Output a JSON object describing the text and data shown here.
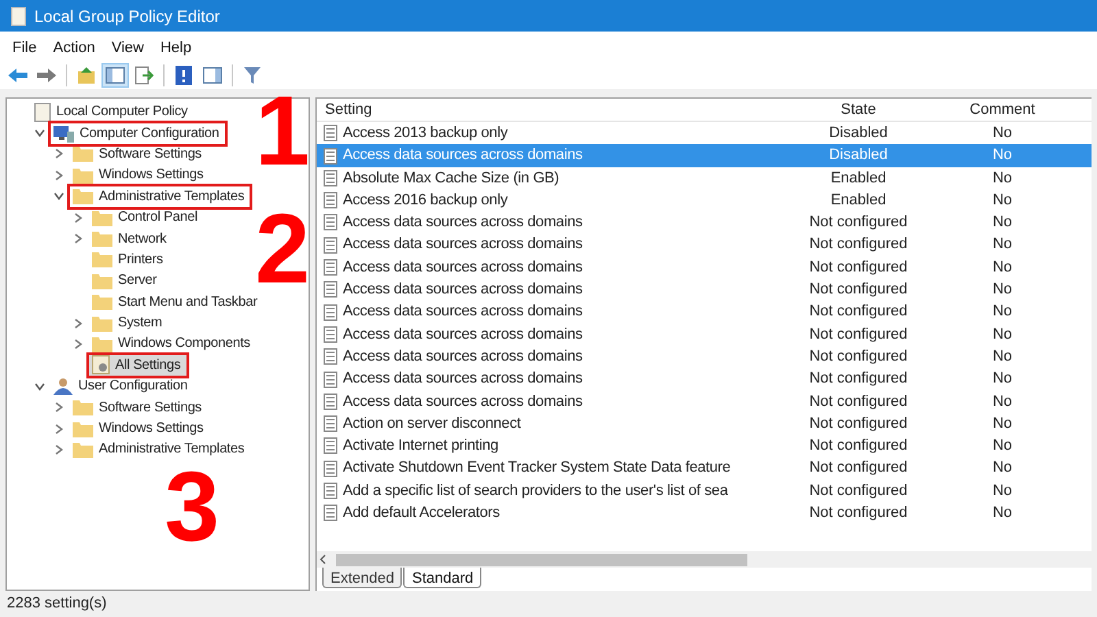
{
  "window": {
    "title": "Local Group Policy Editor"
  },
  "menu": [
    {
      "label": "File"
    },
    {
      "label": "Action"
    },
    {
      "label": "View"
    },
    {
      "label": "Help"
    }
  ],
  "toolbar": [
    {
      "kind": "back"
    },
    {
      "kind": "forward"
    },
    {
      "kind": "sep"
    },
    {
      "kind": "up"
    },
    {
      "kind": "tree",
      "selected": true
    },
    {
      "kind": "export"
    },
    {
      "kind": "sep"
    },
    {
      "kind": "help"
    },
    {
      "kind": "pane"
    },
    {
      "kind": "sep"
    },
    {
      "kind": "filter"
    }
  ],
  "tree": [
    {
      "label": "Local Computer Policy",
      "kind": "policy",
      "expandable": false,
      "expanded": true,
      "selected": false,
      "annotated": false,
      "children": [
        {
          "label": "Computer Configuration",
          "kind": "computer",
          "expandable": true,
          "expanded": true,
          "selected": false,
          "annotated": true,
          "children": [
            {
              "label": "Software Settings",
              "kind": "folder",
              "expandable": true,
              "expanded": false,
              "selected": false,
              "annotated": false
            },
            {
              "label": "Windows Settings",
              "kind": "folder",
              "expandable": true,
              "expanded": false,
              "selected": false,
              "annotated": false
            },
            {
              "label": "Administrative Templates",
              "kind": "folder",
              "expandable": true,
              "expanded": true,
              "selected": false,
              "annotated": true,
              "children": [
                {
                  "label": "Control Panel",
                  "kind": "folder",
                  "expandable": true,
                  "expanded": false,
                  "selected": false,
                  "annotated": false
                },
                {
                  "label": "Network",
                  "kind": "folder",
                  "expandable": true,
                  "expanded": false,
                  "selected": false,
                  "annotated": false
                },
                {
                  "label": "Printers",
                  "kind": "folder",
                  "expandable": false,
                  "selected": false,
                  "annotated": false
                },
                {
                  "label": "Server",
                  "kind": "folder",
                  "expandable": false,
                  "selected": false,
                  "annotated": false
                },
                {
                  "label": "Start Menu and Taskbar",
                  "kind": "folder",
                  "expandable": false,
                  "selected": false,
                  "annotated": false
                },
                {
                  "label": "System",
                  "kind": "folder",
                  "expandable": true,
                  "expanded": false,
                  "selected": false,
                  "annotated": false
                },
                {
                  "label": "Windows Components",
                  "kind": "folder",
                  "expandable": true,
                  "expanded": false,
                  "selected": false,
                  "annotated": false
                },
                {
                  "label": "All Settings",
                  "kind": "settings",
                  "expandable": false,
                  "selected": true,
                  "annotated": true
                }
              ]
            }
          ]
        },
        {
          "label": "User Configuration",
          "kind": "user",
          "expandable": true,
          "expanded": true,
          "selected": false,
          "annotated": false,
          "children": [
            {
              "label": "Software Settings",
              "kind": "folder",
              "expandable": true,
              "expanded": false,
              "selected": false,
              "annotated": false
            },
            {
              "label": "Windows Settings",
              "kind": "folder",
              "expandable": true,
              "expanded": false,
              "selected": false,
              "annotated": false
            },
            {
              "label": "Administrative Templates",
              "kind": "folder",
              "expandable": true,
              "expanded": false,
              "selected": false,
              "annotated": false
            }
          ]
        }
      ]
    }
  ],
  "table": {
    "columns": [
      "Setting",
      "State",
      "Comment"
    ],
    "rows": [
      {
        "setting": "Access 2013 backup only",
        "state": "Disabled",
        "comment": "No",
        "selected": false
      },
      {
        "setting": "Access data sources across domains",
        "state": "Disabled",
        "comment": "No",
        "selected": true
      },
      {
        "setting": "Absolute Max Cache Size (in GB)",
        "state": "Enabled",
        "comment": "No",
        "selected": false
      },
      {
        "setting": "Access 2016 backup only",
        "state": "Enabled",
        "comment": "No",
        "selected": false
      },
      {
        "setting": "Access data sources across domains",
        "state": "Not configured",
        "comment": "No",
        "selected": false
      },
      {
        "setting": "Access data sources across domains",
        "state": "Not configured",
        "comment": "No",
        "selected": false
      },
      {
        "setting": "Access data sources across domains",
        "state": "Not configured",
        "comment": "No",
        "selected": false
      },
      {
        "setting": "Access data sources across domains",
        "state": "Not configured",
        "comment": "No",
        "selected": false
      },
      {
        "setting": "Access data sources across domains",
        "state": "Not configured",
        "comment": "No",
        "selected": false
      },
      {
        "setting": "Access data sources across domains",
        "state": "Not configured",
        "comment": "No",
        "selected": false
      },
      {
        "setting": "Access data sources across domains",
        "state": "Not configured",
        "comment": "No",
        "selected": false
      },
      {
        "setting": "Access data sources across domains",
        "state": "Not configured",
        "comment": "No",
        "selected": false
      },
      {
        "setting": "Access data sources across domains",
        "state": "Not configured",
        "comment": "No",
        "selected": false
      },
      {
        "setting": "Action on server disconnect",
        "state": "Not configured",
        "comment": "No",
        "selected": false
      },
      {
        "setting": "Activate Internet printing",
        "state": "Not configured",
        "comment": "No",
        "selected": false
      },
      {
        "setting": "Activate Shutdown Event Tracker System State Data feature",
        "state": "Not configured",
        "comment": "No",
        "selected": false
      },
      {
        "setting": "Add a specific list of search providers to the user's list of sea",
        "state": "Not configured",
        "comment": "No",
        "selected": false
      },
      {
        "setting": "Add default Accelerators",
        "state": "Not configured",
        "comment": "No",
        "selected": false
      }
    ]
  },
  "view_tabs": [
    {
      "label": "Extended",
      "selected": false
    },
    {
      "label": "Standard",
      "selected": true
    }
  ],
  "status_bar": "2283 setting(s)",
  "annotations": [
    {
      "label": "1"
    },
    {
      "label": "2"
    },
    {
      "label": "3"
    }
  ]
}
